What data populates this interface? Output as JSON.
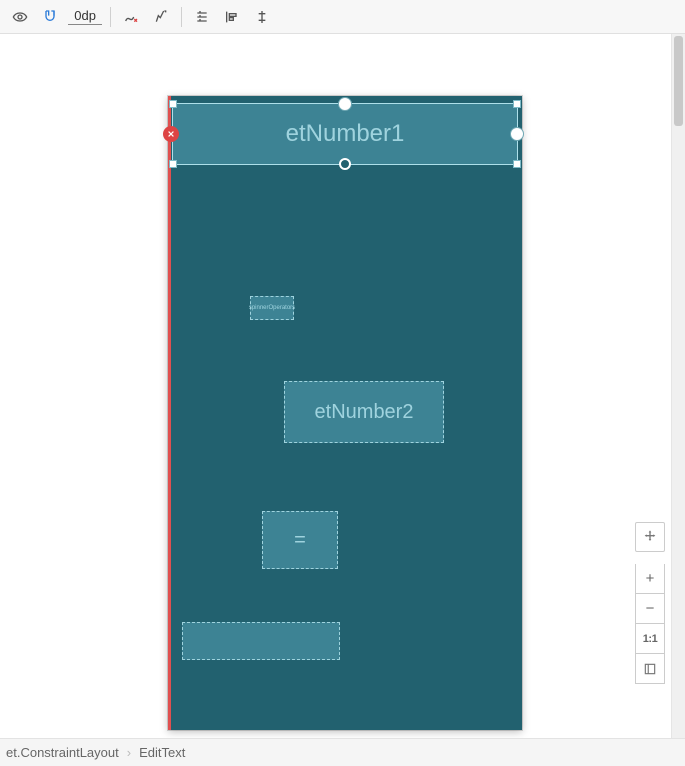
{
  "toolbar": {
    "margin_value": "0dp"
  },
  "zoom": {
    "one_to_one": "1:1"
  },
  "design": {
    "selected": {
      "hint": "etNumber1"
    },
    "spinner_text": "spinnerOperators",
    "et2_hint": "etNumber2",
    "button_label": "="
  },
  "breadcrumb": {
    "parent": "et.ConstraintLayout",
    "child": "EditText"
  }
}
